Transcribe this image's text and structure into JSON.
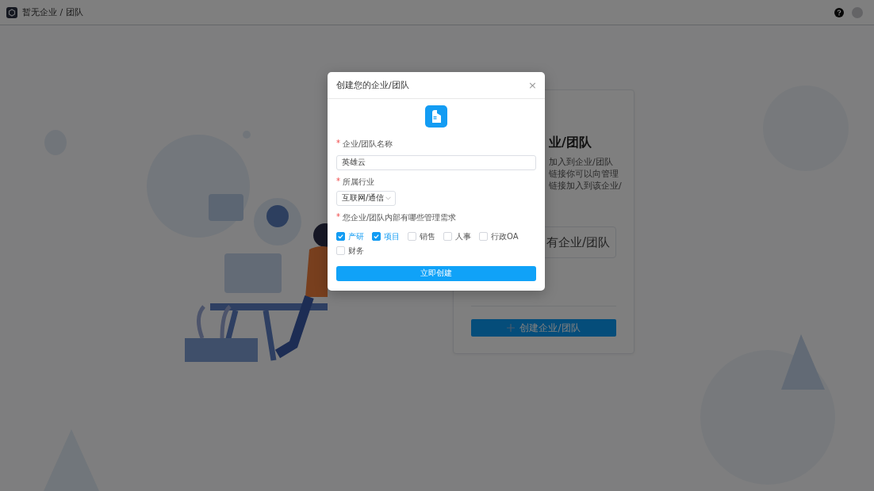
{
  "top_bar": {
    "title": "暂无企业 / 团队"
  },
  "card": {
    "heading": "业/团队",
    "description": [
      "加入到企业/团队",
      "链接你可以向管理",
      "链接加入到该企业/"
    ],
    "join_button": "有企业/团队",
    "create_button": "创建企业/团队"
  },
  "dialog": {
    "title": "创建您的企业/团队",
    "close": "×",
    "fields": [
      {
        "kind": "text",
        "mark": "*",
        "label": "企业/团队名称",
        "value": "英雄云"
      },
      {
        "kind": "select",
        "mark": "*",
        "label": "所属行业",
        "value": "互联网/通信"
      },
      {
        "kind": "checkboxes",
        "mark": "*",
        "label": "您企业/团队内部有哪些管理需求",
        "options": [
          {
            "label": "产研",
            "checked": true
          },
          {
            "label": "项目",
            "checked": true
          },
          {
            "label": "销售",
            "checked": false
          },
          {
            "label": "人事",
            "checked": false
          },
          {
            "label": "行政OA",
            "checked": false
          },
          {
            "label": "财务",
            "checked": false
          }
        ]
      }
    ],
    "submit": "立即创建"
  }
}
